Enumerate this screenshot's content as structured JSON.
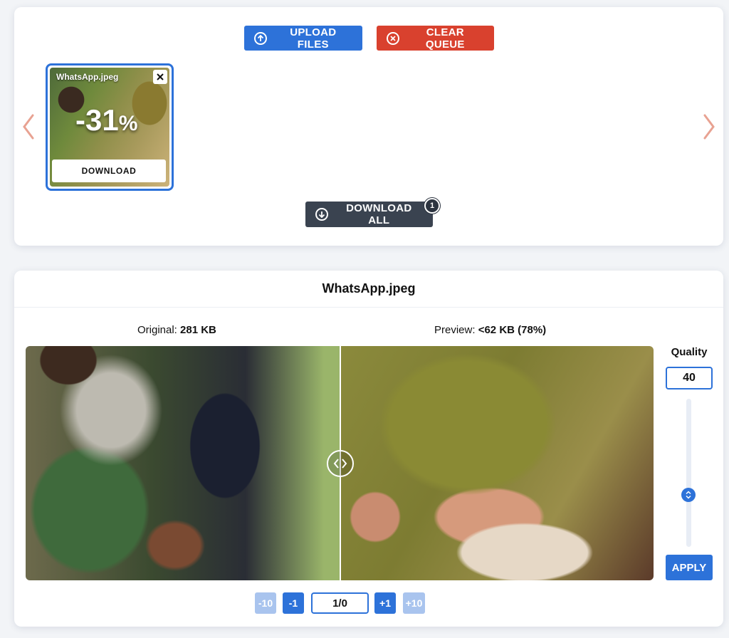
{
  "toolbar": {
    "upload_label": "UPLOAD FILES",
    "clear_label": "CLEAR QUEUE",
    "download_all_label": "DOWNLOAD ALL",
    "download_all_count": "1"
  },
  "queue": {
    "items": [
      {
        "name": "WhatsApp.jpeg",
        "reduction_number": "-31",
        "reduction_sign": "%",
        "download_label": "DOWNLOAD"
      }
    ]
  },
  "viewer": {
    "title": "WhatsApp.jpeg",
    "original_label": "Original:",
    "original_value": "281 KB",
    "preview_label": "Preview:",
    "preview_value": "<62 KB (78%)",
    "quality_label": "Quality",
    "quality_value": "40",
    "quality_level_fraction": 0.4,
    "apply_label": "APPLY",
    "step_minus10": "-10",
    "step_minus1": "-1",
    "step_plus1": "+1",
    "step_plus10": "+10",
    "page_value": "1/0"
  },
  "colors": {
    "primary": "#2d72d9",
    "danger": "#d9412e",
    "dark": "#3a4350"
  },
  "icons": {
    "upload": "arrow-up-circle-icon",
    "clear": "x-circle-icon",
    "download_all": "arrow-down-circle-icon",
    "prev": "chevron-left-icon",
    "next": "chevron-right-icon",
    "close": "close-icon",
    "compare_handle": "code-chevrons-icon",
    "slider": "chevron-up-down-icon"
  }
}
